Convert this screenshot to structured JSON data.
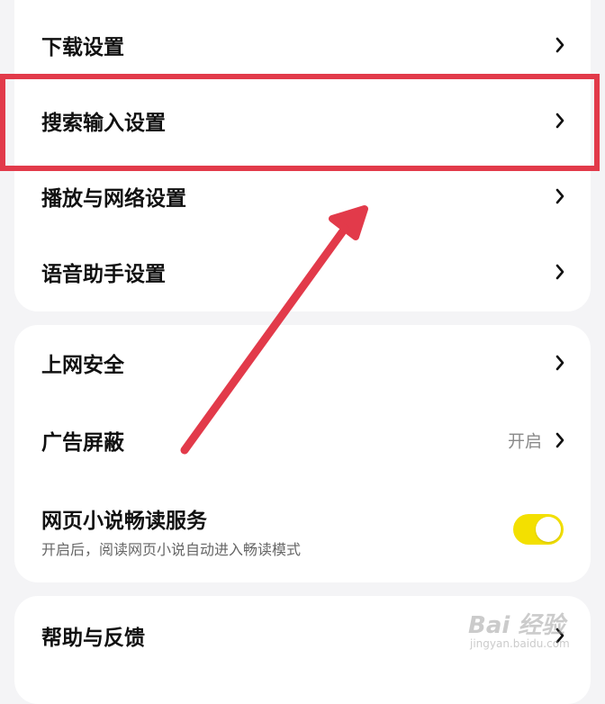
{
  "settings_group_1": {
    "items": [
      {
        "label": "下载设置"
      },
      {
        "label": "搜索输入设置"
      },
      {
        "label": "播放与网络设置"
      },
      {
        "label": "语音助手设置"
      }
    ]
  },
  "settings_group_2": {
    "security": {
      "label": "上网安全"
    },
    "ad_block": {
      "label": "广告屏蔽",
      "value": "开启"
    },
    "novel_reader": {
      "label": "网页小说畅读服务",
      "description": "开启后，阅读网页小说自动进入畅读模式",
      "enabled": true
    }
  },
  "settings_group_3": {
    "help": {
      "label": "帮助与反馈"
    }
  },
  "annotation": {
    "highlight_color": "#e23a4a",
    "arrow_color": "#e23a4a"
  },
  "watermark": {
    "logo": "Bai 经验",
    "url": "jingyan.baidu.com"
  },
  "colors": {
    "toggle_on": "#f3e000",
    "background": "#f4f4f6"
  }
}
